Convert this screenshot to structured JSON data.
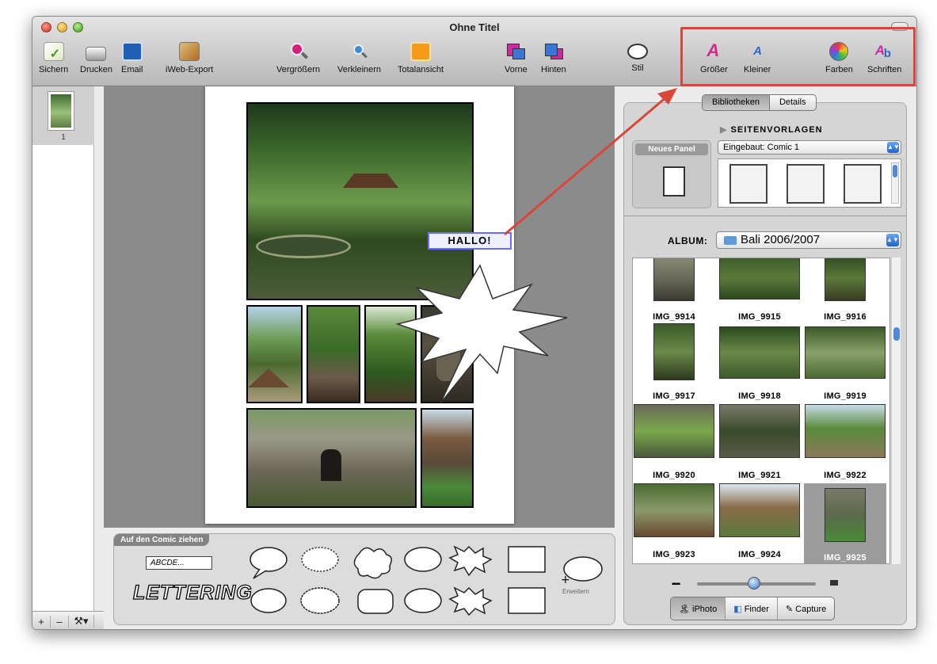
{
  "window": {
    "title": "Ohne Titel"
  },
  "toolbar": {
    "items": [
      {
        "label": "Sichern",
        "icon": "save-icon"
      },
      {
        "label": "Drucken",
        "icon": "printer-icon"
      },
      {
        "label": "Email",
        "icon": "email-icon"
      },
      {
        "label": "iWeb-Export",
        "icon": "iweb-export-icon"
      },
      {
        "label": "Vergrößern",
        "icon": "zoom-in-icon"
      },
      {
        "label": "Verkleinern",
        "icon": "zoom-out-icon"
      },
      {
        "label": "Totalansicht",
        "icon": "fit-view-icon"
      },
      {
        "label": "Vorne",
        "icon": "bring-front-icon"
      },
      {
        "label": "Hinten",
        "icon": "send-back-icon"
      },
      {
        "label": "Stil",
        "icon": "style-icon"
      },
      {
        "label": "Größer",
        "icon": "text-bigger-icon"
      },
      {
        "label": "Kleiner",
        "icon": "text-smaller-icon"
      },
      {
        "label": "Farben",
        "icon": "colors-icon"
      },
      {
        "label": "Schriften",
        "icon": "fonts-icon"
      }
    ]
  },
  "sidebar": {
    "pages": [
      {
        "number": "1"
      }
    ],
    "footer": {
      "add": "+",
      "remove": "–",
      "action": "⚒▾"
    }
  },
  "canvas": {
    "bubble_text": "HALLO!"
  },
  "lettering": {
    "title": "Auf den Comic ziehen",
    "text_box": "ABCDE...",
    "lettering_label": "LETTERING",
    "expand_label": "Erweitern"
  },
  "library": {
    "tabs": [
      "Bibliotheken",
      "Details"
    ],
    "templates_label": "SEITENVORLAGEN",
    "new_panel": "Neues Panel",
    "template_select": "Eingebaut: Comic 1",
    "album_label": "ALBUM:",
    "album_select": "Bali 2006/2007",
    "photos": [
      "IMG_9914",
      "IMG_9915",
      "IMG_9916",
      "IMG_9917",
      "IMG_9918",
      "IMG_9919",
      "IMG_9920",
      "IMG_9921",
      "IMG_9922",
      "IMG_9923",
      "IMG_9924",
      "IMG_9925"
    ],
    "selected_photo": "IMG_9925",
    "sources": [
      "iPhoto",
      "Finder",
      "Capture"
    ],
    "active_source": "iPhoto"
  },
  "colors": {
    "highlight": "#d8483a",
    "accent": "#2d72cc"
  }
}
